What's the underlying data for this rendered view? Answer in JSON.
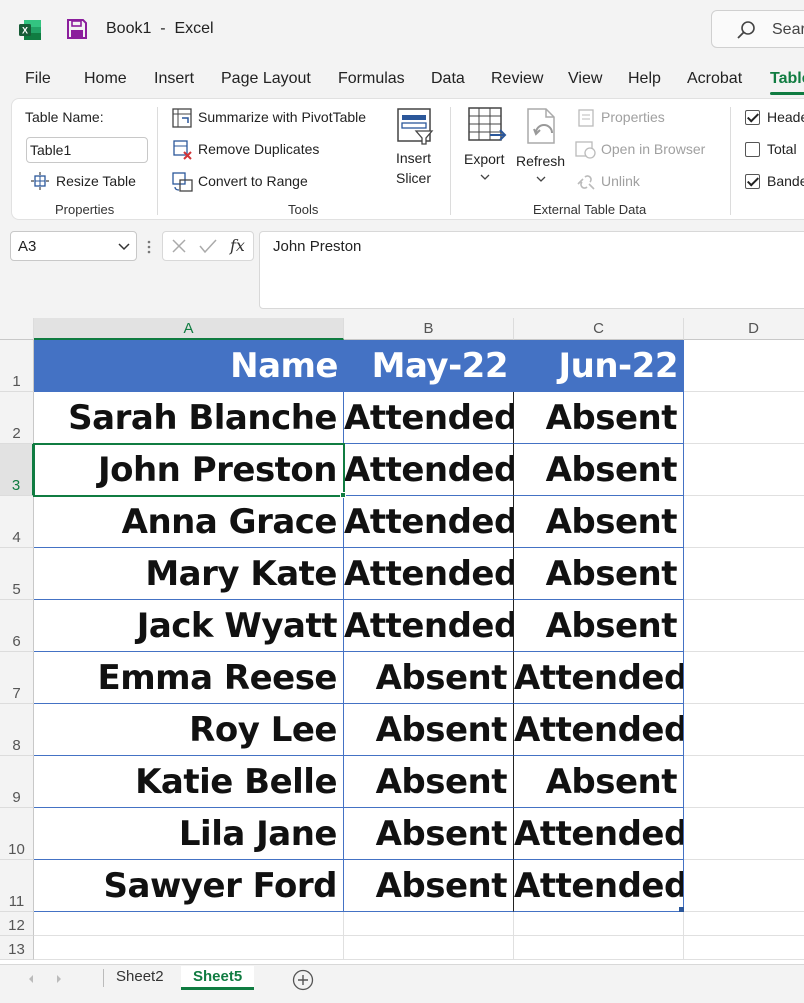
{
  "title": {
    "doc_name": "Book1",
    "separator": "-",
    "app_name": "Excel",
    "search_placeholder": "Sear"
  },
  "menu": [
    "File",
    "Home",
    "Insert",
    "Page Layout",
    "Formulas",
    "Data",
    "Review",
    "View",
    "Help",
    "Acrobat",
    "Table"
  ],
  "menu_active": "Table",
  "ribbon": {
    "properties": {
      "table_name_label": "Table Name:",
      "table_name_value": "Table1",
      "resize_label": "Resize Table",
      "group_label": "Properties"
    },
    "tools": {
      "pivot_label": "Summarize with PivotTable",
      "remove_dup_label": "Remove Duplicates",
      "convert_label": "Convert to Range",
      "slicer_label_1": "Insert",
      "slicer_label_2": "Slicer",
      "group_label": "Tools"
    },
    "external": {
      "export_label": "Export",
      "refresh_label": "Refresh",
      "properties_label": "Properties",
      "open_browser_label": "Open in Browser",
      "unlink_label": "Unlink",
      "group_label": "External Table Data"
    },
    "style_options": {
      "header_row_label": "Heade",
      "header_row_checked": true,
      "total_row_label": "Total",
      "total_row_checked": false,
      "banded_rows_label": "Bande",
      "banded_rows_checked": true
    }
  },
  "formula_bar": {
    "name_box": "A3",
    "formula": "John Preston"
  },
  "columns": [
    "A",
    "B",
    "C",
    "D"
  ],
  "selected_column": "A",
  "rows": [
    "1",
    "2",
    "3",
    "4",
    "5",
    "6",
    "7",
    "8",
    "9",
    "10",
    "11",
    "12",
    "13"
  ],
  "selected_row": "3",
  "table": {
    "headers": [
      "Name",
      "May-22",
      "Jun-22"
    ],
    "header_color": "#4472c4",
    "data": [
      [
        "Sarah Blanche",
        "Attended",
        "Absent"
      ],
      [
        "John Preston",
        "Attended",
        "Absent"
      ],
      [
        "Anna Grace",
        "Attended",
        "Absent"
      ],
      [
        "Mary Kate",
        "Attended",
        "Absent"
      ],
      [
        "Jack Wyatt",
        "Attended",
        "Absent"
      ],
      [
        "Emma Reese",
        "Absent",
        "Attended"
      ],
      [
        "Roy Lee",
        "Absent",
        "Attended"
      ],
      [
        "Katie Belle",
        "Absent",
        "Absent"
      ],
      [
        "Lila Jane",
        "Absent",
        "Attended"
      ],
      [
        "Sawyer Ford",
        "Absent",
        "Attended"
      ]
    ]
  },
  "sheets": [
    "Sheet2",
    "Sheet5"
  ],
  "active_sheet": "Sheet5",
  "accent_color": "#107c41"
}
